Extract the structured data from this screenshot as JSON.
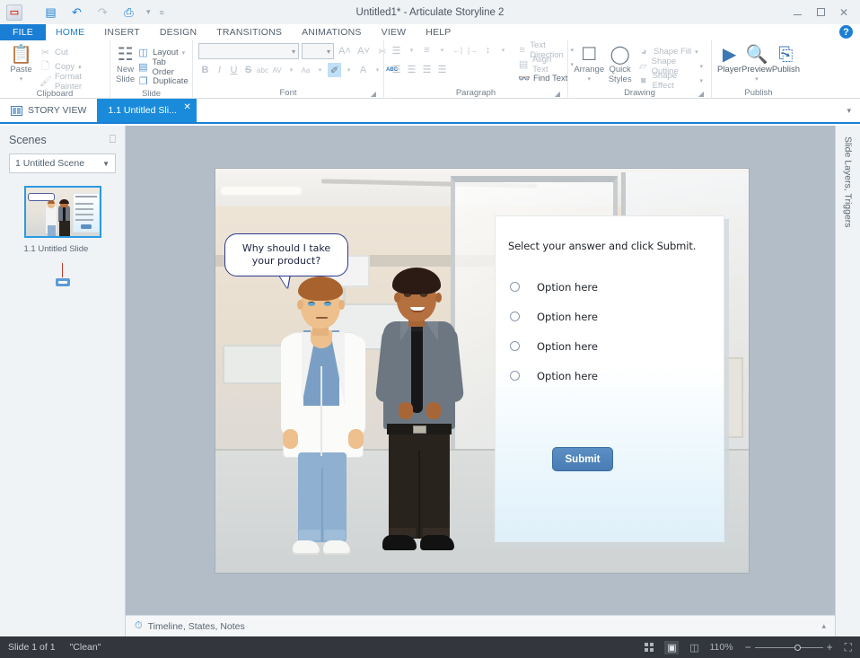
{
  "window": {
    "title": "Untitled1* -  Articulate Storyline 2",
    "logo_icon": "storyline-logo-icon",
    "quick_access": [
      {
        "name": "save-button",
        "icon": "save-icon",
        "glyph": "▤"
      },
      {
        "name": "undo-button",
        "icon": "undo-icon",
        "glyph": "↶"
      },
      {
        "name": "redo-button",
        "icon": "redo-icon",
        "glyph": "↷"
      },
      {
        "name": "print-button",
        "icon": "print-icon",
        "glyph": "⎙"
      }
    ],
    "controls": {
      "minimize": "minimize-icon",
      "maximize": "maximize-icon",
      "close": "✕"
    }
  },
  "menu": {
    "tabs": [
      {
        "label": "FILE",
        "state": "file"
      },
      {
        "label": "HOME",
        "state": "active"
      },
      {
        "label": "INSERT",
        "state": "normal"
      },
      {
        "label": "DESIGN",
        "state": "normal"
      },
      {
        "label": "TRANSITIONS",
        "state": "normal"
      },
      {
        "label": "ANIMATIONS",
        "state": "normal"
      },
      {
        "label": "VIEW",
        "state": "normal"
      },
      {
        "label": "HELP",
        "state": "normal"
      }
    ],
    "help_glyph": "?"
  },
  "ribbon": {
    "clipboard": {
      "label": "Clipboard",
      "paste": "Paste",
      "paste_caret": "▾",
      "cut": "Cut",
      "copy": "Copy",
      "copy_caret": "▾",
      "format_painter": "Format Painter"
    },
    "slide": {
      "label": "Slide",
      "new_slide": "New\nSlide",
      "new_slide_line1": "New",
      "new_slide_line2": "Slide",
      "layout": "Layout",
      "layout_caret": "▾",
      "tab_order": "Tab Order",
      "duplicate": "Duplicate"
    },
    "font": {
      "label": "Font",
      "name_value": "",
      "name_caret": "▾",
      "size_value": "",
      "size_caret": "▾",
      "grow_font": "A˄",
      "shrink_font": "A˅",
      "clear_formatting": "✂",
      "bold": "B",
      "italic": "I",
      "underline": "U",
      "strikethrough": "S",
      "small_caps": "abc",
      "character_spacing": "AV",
      "change_case": "Aa",
      "text_highlight": "✐",
      "font_color": "A",
      "spell_check": "ABC",
      "caret": "▾"
    },
    "paragraph": {
      "label": "Paragraph",
      "bullets": "☰",
      "numbering": "≡",
      "decrease_indent": "←|",
      "increase_indent": "|→",
      "line_spacing": "↕",
      "align_left": "☰",
      "align_center": "☰",
      "align_right": "☰",
      "justify": "☰",
      "text_direction": "Text Direction",
      "align_text": "Align Text",
      "find_text": "Find Text",
      "caret": "▾"
    },
    "drawing": {
      "label": "Drawing",
      "arrange": "Arrange",
      "arrange_caret": "▾",
      "quick_styles_line1": "Quick",
      "quick_styles_line2": "Styles",
      "quick_styles_caret": "▾",
      "shape_fill": "Shape Fill",
      "shape_outline": "Shape Outline",
      "shape_effect": "Shape Effect",
      "caret": "▾"
    },
    "publish": {
      "label": "Publish",
      "player": "Player",
      "preview": "Preview",
      "preview_caret": "▾",
      "publish": "Publish"
    }
  },
  "tabstrip": {
    "story_view": "STORY VIEW",
    "story_view_icon": "story-view-icon",
    "slide_tab": "1.1 Untitled Sli...",
    "slide_tab_close": "✕",
    "overflow_caret": "▾"
  },
  "scenes_panel": {
    "title": "Scenes",
    "header_icon": "collapse-panel-icon",
    "scene_select_value": "1 Untitled Scene",
    "scene_select_caret": "▼",
    "thumbnail_label": "1.1 Untitled Slide",
    "trigger_icon": "trigger-link-icon"
  },
  "slide": {
    "speech_bubble": "Why should I take your product?",
    "characters": [
      {
        "name": "doctor-character",
        "description": "doctor-white-coat"
      },
      {
        "name": "businessman-character",
        "description": "man-grey-shirt-black-tie"
      }
    ],
    "quiz": {
      "prompt": "Select your answer and click Submit.",
      "options": [
        {
          "label": "Option here",
          "selected": false
        },
        {
          "label": "Option here",
          "selected": false
        },
        {
          "label": "Option here",
          "selected": false
        },
        {
          "label": "Option here",
          "selected": false
        }
      ],
      "submit_label": "Submit",
      "submit_color": "#4f82b8"
    }
  },
  "timeline_bar": {
    "label": "Timeline, States, Notes",
    "icon": "timeline-icon",
    "caret": "▴"
  },
  "right_panel": {
    "label": "Slide Layers, Triggers"
  },
  "status_bar": {
    "slide_counter": "Slide 1 of 1",
    "theme": "\"Clean\"",
    "view_buttons": [
      {
        "name": "story-view-button",
        "icon": "grid-icon",
        "active": false
      },
      {
        "name": "slide-view-button",
        "icon": "slide-icon",
        "active": true
      },
      {
        "name": "form-view-button",
        "icon": "form-icon",
        "active": false
      }
    ],
    "zoom_level": "110%",
    "zoom_minus": "−",
    "zoom_plus": "+",
    "fit_icon": "fit-to-window-icon"
  },
  "colors": {
    "accent": "#1a7fd4",
    "tab_selected": "#1a8bdb",
    "canvas_bg": "#b3bdc7",
    "status_bg": "#33363d",
    "submit_blue": "#4f82b8"
  }
}
